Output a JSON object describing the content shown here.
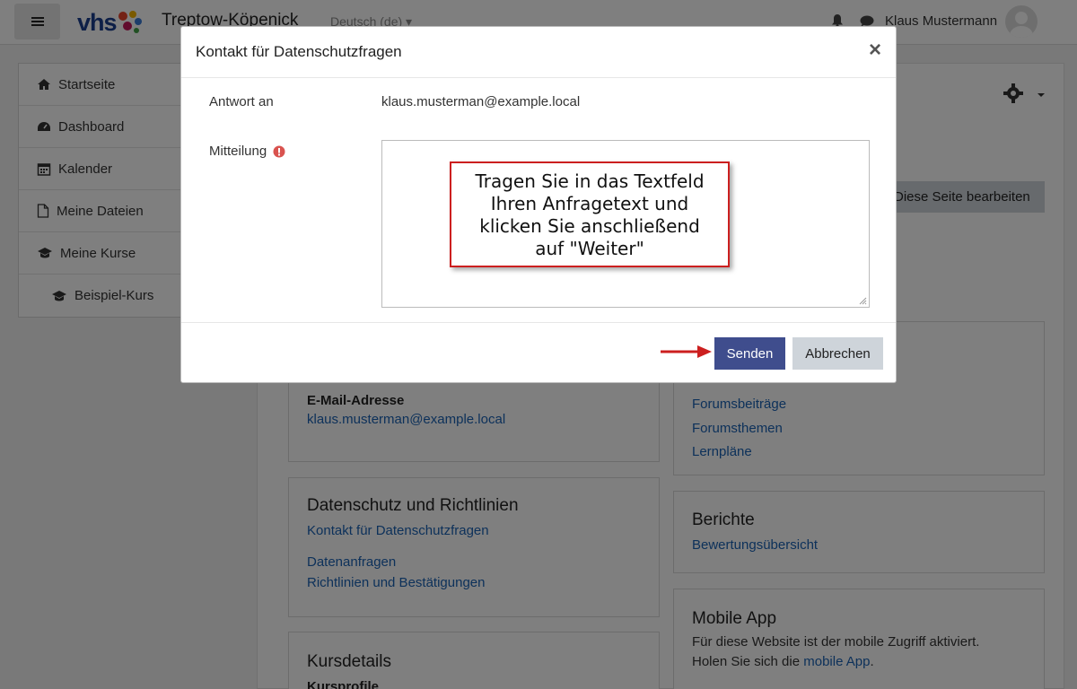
{
  "navbar": {
    "logo_text": "vhs",
    "site_name": "Treptow-Köpenick",
    "language": "Deutsch (de)",
    "user_name": "Klaus Mustermann"
  },
  "leftnav": {
    "items": [
      {
        "label": "Startseite",
        "icon": "home-icon"
      },
      {
        "label": "Dashboard",
        "icon": "dashboard-icon"
      },
      {
        "label": "Kalender",
        "icon": "calendar-icon"
      },
      {
        "label": "Meine Dateien",
        "icon": "file-icon"
      },
      {
        "label": "Meine Kurse",
        "icon": "graduation-cap-icon"
      },
      {
        "label": "Beispiel-Kurs",
        "icon": "graduation-cap-icon"
      }
    ]
  },
  "main": {
    "edit_button": "Diese Seite bearbeiten",
    "profile_card": {
      "email_heading": "E-Mail-Adresse",
      "email_value": "klaus.musterman@example.local"
    },
    "misc_card": {
      "links": [
        "Forumsbeiträge",
        "Forumsthemen",
        "Lernpläne"
      ]
    },
    "privacy_card": {
      "title": "Datenschutz und Richtlinien",
      "links": [
        "Kontakt für Datenschutzfragen",
        "Datenanfragen",
        "Richtlinien und Bestätigungen"
      ]
    },
    "reports_card": {
      "title": "Berichte",
      "links": [
        "Bewertungsübersicht"
      ]
    },
    "course_card": {
      "title": "Kursdetails",
      "subtitle": "Kursprofile"
    },
    "mobile_card": {
      "title": "Mobile App",
      "line1": "Für diese Website ist der mobile Zugriff aktiviert.",
      "line2_prefix": "Holen Sie sich die ",
      "line2_link": "mobile App",
      "line2_suffix": "."
    }
  },
  "modal": {
    "title": "Kontakt für Datenschutzfragen",
    "close_symbol": "×",
    "reply_label": "Antwort an",
    "reply_value": "klaus.musterman@example.local",
    "message_label": "Mitteilung",
    "message_value": "",
    "send_button": "Senden",
    "cancel_button": "Abbrechen"
  },
  "callout": {
    "lines": [
      "Tragen Sie in das Textfeld",
      "Ihren Anfragetext und",
      "klicken Sie anschließend",
      "auf \"Weiter\""
    ]
  },
  "colors": {
    "primary": "#3f4d8d",
    "link": "#1a62b5",
    "callout_border": "#cc1f1f",
    "required_icon": "#d9534f"
  }
}
